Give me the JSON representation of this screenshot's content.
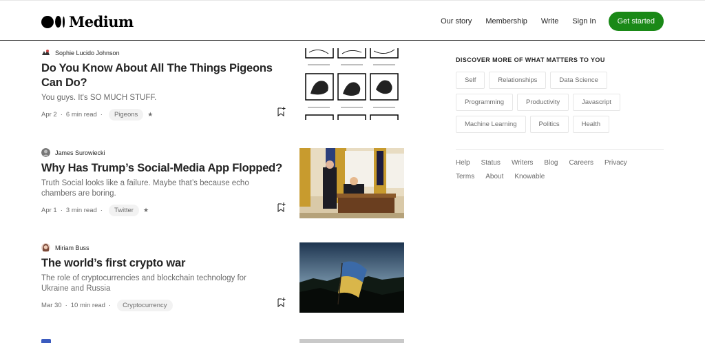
{
  "header": {
    "logo_text": "Medium",
    "nav": [
      "Our story",
      "Membership",
      "Write",
      "Sign In"
    ],
    "cta": "Get started"
  },
  "articles": [
    {
      "author": "Sophie Lucido Johnson",
      "title": "Do You Know About All The Things Pigeons Can Do?",
      "subtitle": "You guys. It's SO MUCH STUFF.",
      "date": "Apr 2",
      "read_time": "6 min read",
      "tag": "Pigeons",
      "member_star": "★"
    },
    {
      "author": "James Surowiecki",
      "title": "Why Has Trump’s Social-Media App Flopped?",
      "subtitle": "Truth Social looks like a failure. Maybe that’s because echo chambers are boring.",
      "date": "Apr 1",
      "read_time": "3 min read",
      "tag": "Twitter",
      "member_star": "★"
    },
    {
      "author": "Miriam Buss",
      "title": "The world’s first crypto war",
      "subtitle": "The role of cryptocurrencies and blockchain technology for Ukraine and Russia",
      "date": "Mar 30",
      "read_time": "10 min read",
      "tag": "Cryptocurrency"
    }
  ],
  "sidebar": {
    "heading": "DISCOVER MORE OF WHAT MATTERS TO YOU",
    "topics": [
      "Self",
      "Relationships",
      "Data Science",
      "Programming",
      "Productivity",
      "Javascript",
      "Machine Learning",
      "Politics",
      "Health"
    ],
    "footer_links": [
      "Help",
      "Status",
      "Writers",
      "Blog",
      "Careers",
      "Privacy",
      "Terms",
      "About",
      "Knowable"
    ]
  },
  "colors": {
    "brand_green": "#1a8917",
    "text_primary": "#242424",
    "text_secondary": "#6b6b6b"
  }
}
